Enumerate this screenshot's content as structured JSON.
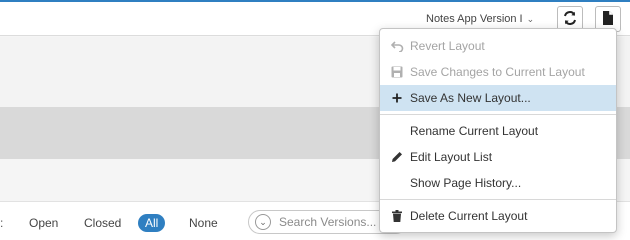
{
  "topbar": {
    "version_select": "Notes App Version I",
    "refresh_icon": "refresh-icon",
    "document_icon": "document-icon"
  },
  "filters": {
    "colon": ":",
    "open": "Open",
    "closed": "Closed",
    "all": "All",
    "none": "None",
    "search_placeholder": "Search Versions..."
  },
  "menu": {
    "revert": "Revert Layout",
    "save_changes": "Save Changes to Current Layout",
    "save_new": "Save As New Layout...",
    "rename": "Rename Current Layout",
    "edit_list": "Edit Layout List",
    "history": "Show Page History...",
    "delete": "Delete Current Layout"
  },
  "colors": {
    "accent": "#2f7fc1",
    "highlight": "#cfe3f2",
    "disabled_text": "#a4a4a4"
  }
}
